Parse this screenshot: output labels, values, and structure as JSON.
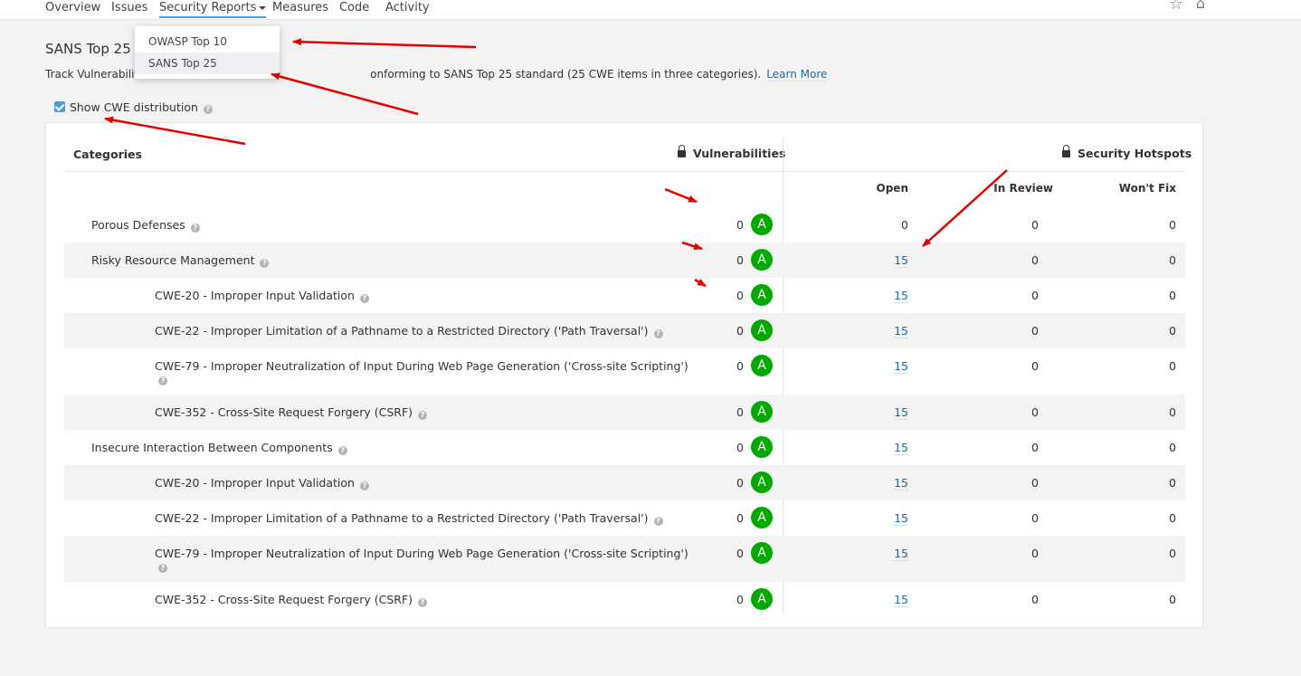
{
  "nav": {
    "items": [
      "Overview",
      "Issues",
      "Security Reports",
      "Measures",
      "Code",
      "Activity"
    ],
    "active": "Security Reports"
  },
  "dropdown": {
    "options": [
      "OWASP Top 10",
      "SANS Top 25"
    ],
    "selected": "SANS Top 25"
  },
  "page": {
    "title": "SANS Top 25",
    "desc_start": "Track Vulnerabilit",
    "desc_end": "onforming to SANS Top 25 standard (25 CWE items in three categories).",
    "learn_more": "Learn More",
    "show_cwe_label": "Show CWE distribution",
    "show_cwe_checked": true
  },
  "table": {
    "headers": {
      "categories": "Categories",
      "vulnerabilities": "Vulnerabilities",
      "hotspots": "Security Hotspots",
      "open": "Open",
      "in_review": "In Review",
      "wont_fix": "Won't Fix"
    },
    "rows": [
      {
        "name": "Porous Defenses",
        "vuln": "0",
        "rating": "A",
        "open": "0",
        "review": "0",
        "wontfix": "0"
      },
      {
        "name": "Risky Resource Management",
        "vuln": "0",
        "rating": "A",
        "open": "15",
        "review": "0",
        "wontfix": "0"
      },
      {
        "name": "CWE-20 - Improper Input Validation",
        "vuln": "0",
        "rating": "A",
        "open": "15",
        "review": "0",
        "wontfix": "0"
      },
      {
        "name": "CWE-22 - Improper Limitation of a Pathname to a Restricted Directory ('Path Traversal')",
        "vuln": "0",
        "rating": "A",
        "open": "15",
        "review": "0",
        "wontfix": "0"
      },
      {
        "name": "CWE-79 - Improper Neutralization of Input During Web Page Generation ('Cross-site Scripting')",
        "vuln": "0",
        "rating": "A",
        "open": "15",
        "review": "0",
        "wontfix": "0"
      },
      {
        "name": "CWE-352 - Cross-Site Request Forgery (CSRF)",
        "vuln": "0",
        "rating": "A",
        "open": "15",
        "review": "0",
        "wontfix": "0"
      },
      {
        "name": "Insecure Interaction Between Components",
        "vuln": "0",
        "rating": "A",
        "open": "15",
        "review": "0",
        "wontfix": "0"
      },
      {
        "name": "CWE-20 - Improper Input Validation",
        "vuln": "0",
        "rating": "A",
        "open": "15",
        "review": "0",
        "wontfix": "0"
      },
      {
        "name": "CWE-22 - Improper Limitation of a Pathname to a Restricted Directory ('Path Traversal')",
        "vuln": "0",
        "rating": "A",
        "open": "15",
        "review": "0",
        "wontfix": "0"
      },
      {
        "name": "CWE-79 - Improper Neutralization of Input During Web Page Generation ('Cross-site Scripting')",
        "vuln": "0",
        "rating": "A",
        "open": "15",
        "review": "0",
        "wontfix": "0"
      },
      {
        "name": "CWE-352 - Cross-Site Request Forgery (CSRF)",
        "vuln": "0",
        "rating": "A",
        "open": "15",
        "review": "0",
        "wontfix": "0"
      }
    ]
  },
  "colors": {
    "rating_a": "#00aa00",
    "link": "#236a97",
    "accent": "#4b9fd5",
    "annotation": "#e60000"
  }
}
